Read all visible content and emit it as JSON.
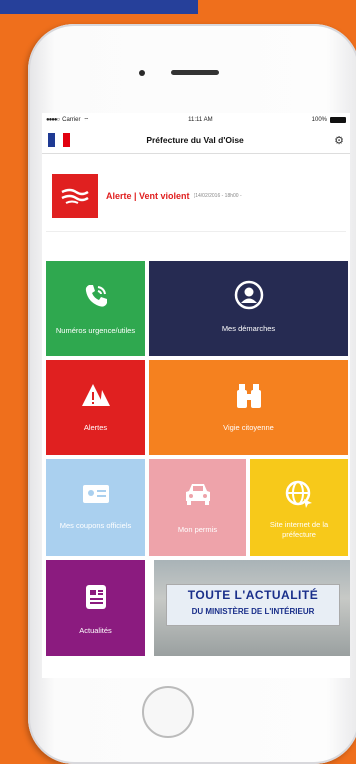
{
  "status_bar": {
    "carrier": "Carrier",
    "time": "11:11 AM",
    "battery": "100%"
  },
  "nav": {
    "title": "Préfecture du Val d'Oise"
  },
  "alert": {
    "title": "Alerte | Vent violent",
    "detail": "(14/02/2016 - 18h00 -"
  },
  "tiles": {
    "numeros": "Numéros urgence/utiles",
    "demarches": "Mes démarches",
    "alertes": "Alertes",
    "vigie": "Vigie citoyenne",
    "coupons": "Mes coupons officiels",
    "permis": "Mon permis",
    "site": "Site internet de la préfecture",
    "actualites": "Actualités"
  },
  "news_banner": {
    "line1": "TOUTE L'ACTUALITÉ",
    "line2": "DU MINISTÈRE DE L'INTÉRIEUR"
  },
  "colors": {
    "background": "#ef6f1c",
    "green": "#2fa84f",
    "navy": "#262b52",
    "red": "#e02020",
    "orange": "#f5811f",
    "light_blue": "#aad0ef",
    "pink": "#eea3aa",
    "yellow": "#f7c91a",
    "purple": "#8b1b7f"
  },
  "icons": [
    "phone-icon",
    "user-circle-icon",
    "warning-icon",
    "binoculars-icon",
    "id-card-icon",
    "car-icon",
    "globe-icon",
    "newspaper-icon",
    "gear-icon",
    "wind-icon"
  ]
}
